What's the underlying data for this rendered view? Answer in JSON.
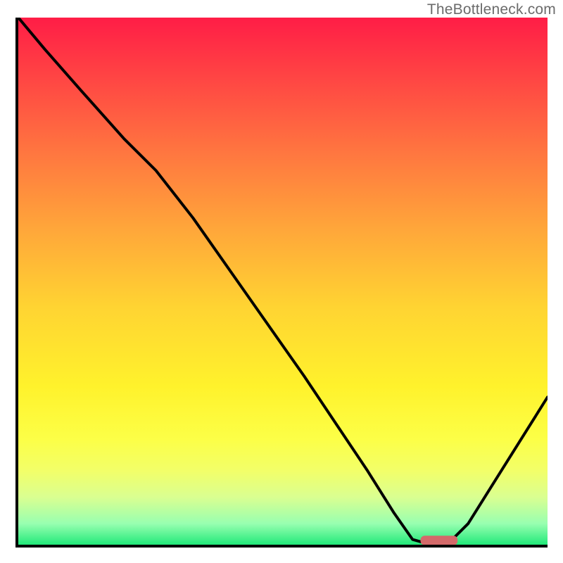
{
  "watermark": "TheBottleneck.com",
  "chart_data": {
    "type": "line",
    "title": "",
    "xlabel": "",
    "ylabel": "",
    "xlim": [
      0,
      100
    ],
    "ylim": [
      0,
      100
    ],
    "grid": false,
    "legend": false,
    "background_gradient": {
      "stops": [
        {
          "pos": 0,
          "color": "#ff1d46"
        },
        {
          "pos": 10,
          "color": "#ff4044"
        },
        {
          "pos": 25,
          "color": "#ff7440"
        },
        {
          "pos": 40,
          "color": "#ffa63a"
        },
        {
          "pos": 55,
          "color": "#ffd432"
        },
        {
          "pos": 70,
          "color": "#fff22c"
        },
        {
          "pos": 80,
          "color": "#fcff47"
        },
        {
          "pos": 86,
          "color": "#f2ff69"
        },
        {
          "pos": 91,
          "color": "#daff91"
        },
        {
          "pos": 96,
          "color": "#98ffb0"
        },
        {
          "pos": 100,
          "color": "#22e97a"
        }
      ]
    },
    "series": [
      {
        "name": "bottleneck-curve",
        "color": "#000000",
        "x": [
          0,
          5,
          12,
          20,
          26,
          33,
          40,
          47,
          54,
          60,
          66,
          71,
          74.5,
          78,
          81,
          85,
          90,
          95,
          100
        ],
        "values": [
          100,
          94,
          86,
          77,
          71,
          62,
          52,
          42,
          32,
          23,
          14,
          6,
          1,
          0,
          0,
          4,
          12,
          20,
          28
        ]
      }
    ],
    "marker": {
      "name": "optimal-range",
      "type": "bar-segment",
      "x_start": 76,
      "x_end": 83,
      "y": 0.3,
      "color": "#d46a6a"
    }
  }
}
